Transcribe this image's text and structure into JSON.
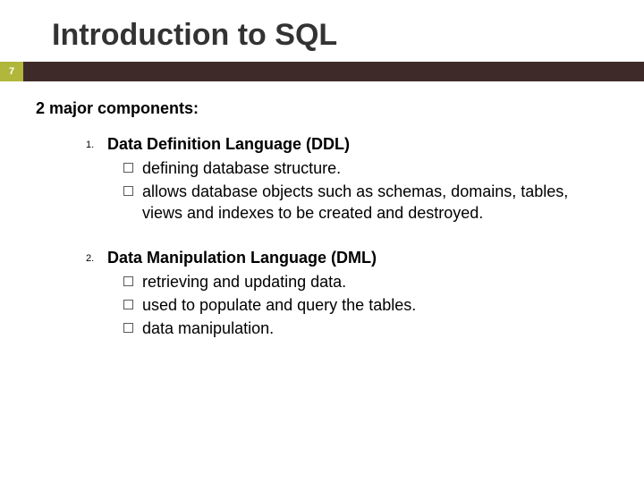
{
  "title": "Introduction to SQL",
  "page": "7",
  "subhead": "2 major components:",
  "items": [
    {
      "num": "1.",
      "title": "Data Definition Language (DDL)",
      "bullets": [
        "defining database structure.",
        "allows database objects such as schemas, domains, tables, views and indexes to be created and destroyed."
      ]
    },
    {
      "num": "2.",
      "title": "Data Manipulation Language (DML)",
      "bullets": [
        "retrieving and updating data.",
        "used to populate and query the tables.",
        "data manipulation."
      ]
    }
  ]
}
